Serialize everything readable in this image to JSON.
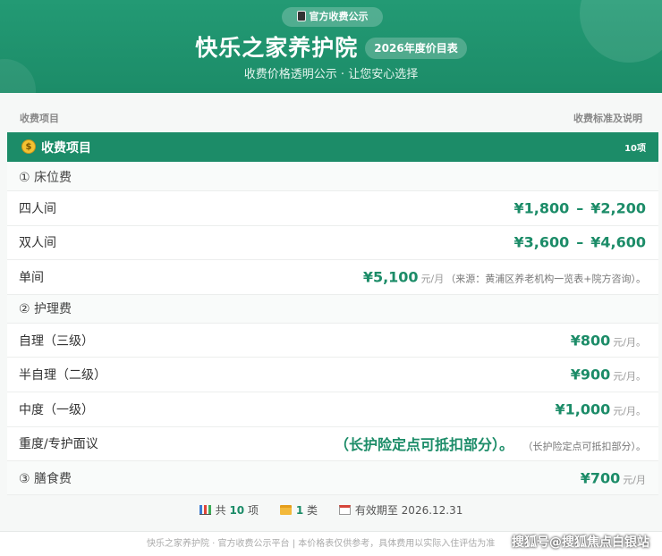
{
  "header": {
    "badge": "官方收费公示",
    "title": "快乐之家养护院",
    "year_pill": "2026年度价目表",
    "subtitle": "收费价格透明公示 · 让您安心选择"
  },
  "columns": {
    "left": "收费项目",
    "right": "收费标准及说明"
  },
  "category": {
    "icon": "moneybag-icon",
    "name": "收费项目",
    "count": "10项"
  },
  "rows": [
    {
      "label": "① 床位费"
    },
    {
      "label": "四人间",
      "price": "¥1,800",
      "dash": "–",
      "price2": "¥2,200"
    },
    {
      "label": "双人间",
      "price": "¥3,600",
      "dash": "–",
      "price2": "¥4,600"
    },
    {
      "label": "单间",
      "price": "¥5,100",
      "unit": "元/月",
      "note": "（来源：黄浦区养老机构一览表+院方咨询）。"
    },
    {
      "label": "② 护理费"
    },
    {
      "label": "自理（三级）",
      "price": "¥800",
      "unit": "元/月。"
    },
    {
      "label": "半自理（二级）",
      "price": "¥900",
      "unit": "元/月。"
    },
    {
      "label": "中度（一级）",
      "price": "¥1,000",
      "unit": "元/月。"
    },
    {
      "label": "重度/专护面议",
      "big_note": "（长护险定点可抵扣部分）。",
      "note": "（长护险定点可抵扣部分）。"
    },
    {
      "label": "③ 膳食费",
      "price": "¥700",
      "unit": "元/月"
    }
  ],
  "stats": {
    "total_prefix": "共",
    "total_num": "10",
    "total_suffix": "项",
    "cat_num": "1",
    "cat_suffix": "类",
    "valid": "有效期至 2026.12.31"
  },
  "footer": {
    "text": "快乐之家养护院 · 官方收费公示平台 | 本价格表仅供参考，具体费用以实际入住评估为准"
  },
  "watermark": "搜狐号@搜狐焦点白银站",
  "colors": {
    "primary": "#1c8c68",
    "header": "#239a74"
  }
}
